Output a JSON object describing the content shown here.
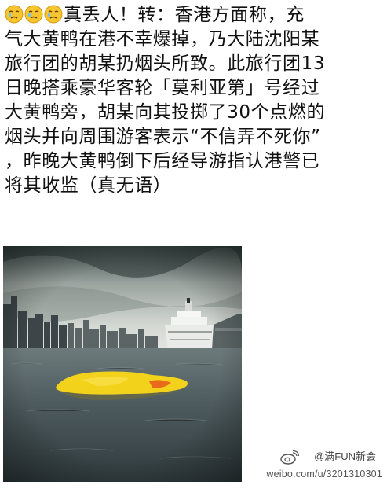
{
  "post": {
    "emoji_icon": "crying-face-icon",
    "lines": [
      "真丢人！转：香港方面称，充",
      "气大黄鸭在港不幸爆掉，乃大陆沈阳某",
      "旅行团的胡某扔烟头所致。此旅行团13",
      "日晚搭乘豪华客轮「莫利亚第」号经过",
      "大黄鸭旁，胡某向其投掷了30个点燃的",
      "烟头并向周围游客表示“不信弄不死你”",
      "，昨晚大黄鸭倒下后经导游指认港警已",
      "将其收监（真无语）"
    ]
  },
  "photo": {
    "subject": "deflated-rubber-duck-photo"
  },
  "watermark": {
    "account": "@满FUN新会",
    "url": "weibo.com/u/3201310301",
    "logo_icon": "weibo-logo-icon"
  },
  "colors": {
    "text": "#111111",
    "duck": "#f3d21c",
    "water": "#4e5a5d",
    "sky": "#c9cdc8"
  }
}
